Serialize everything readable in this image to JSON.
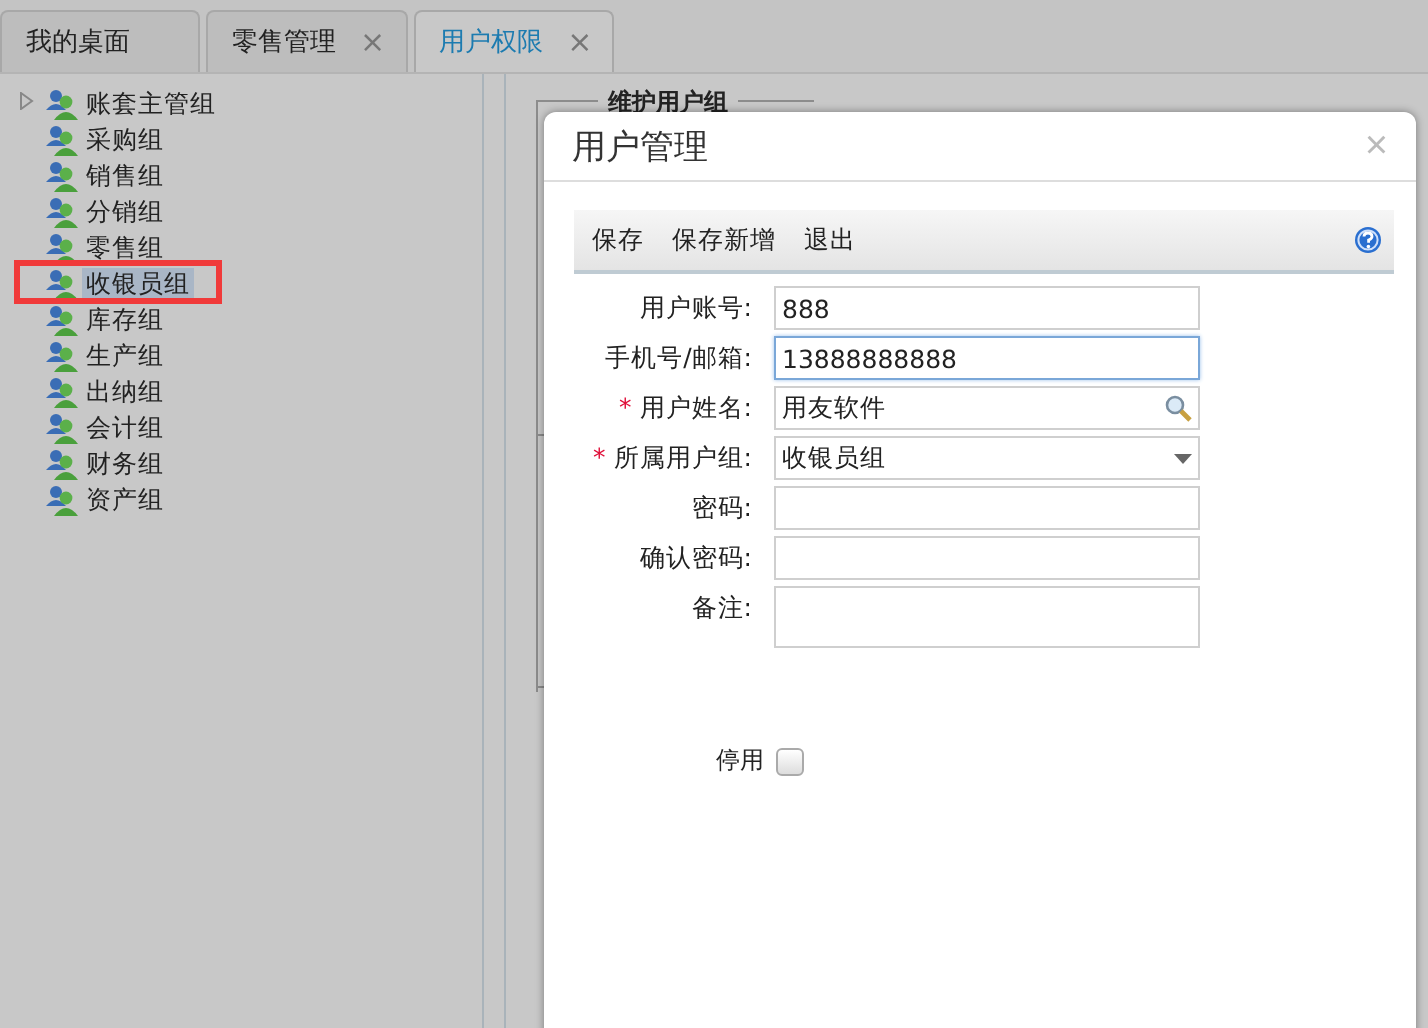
{
  "tabs": [
    {
      "label": "我的桌面",
      "selected": false
    },
    {
      "label": "零售管理",
      "close": "×",
      "selected": false
    },
    {
      "label": "用户权限",
      "close": "×",
      "selected": true
    }
  ],
  "tree": {
    "items": [
      {
        "label": "账套主管组",
        "expanded": false,
        "selected": false
      },
      {
        "label": "采购组",
        "selected": false
      },
      {
        "label": "销售组",
        "selected": false
      },
      {
        "label": "分销组",
        "selected": false
      },
      {
        "label": "零售组",
        "selected": false
      },
      {
        "label": "收银员组",
        "selected": true
      },
      {
        "label": "库存组",
        "selected": false
      },
      {
        "label": "生产组",
        "selected": false
      },
      {
        "label": "出纳组",
        "selected": false
      },
      {
        "label": "会计组",
        "selected": false
      },
      {
        "label": "财务组",
        "selected": false
      },
      {
        "label": "资产组",
        "selected": false
      }
    ]
  },
  "background_panel": {
    "legend": "维护用户组"
  },
  "dialog": {
    "title": "用户管理",
    "close": "×",
    "required_symbol": "*",
    "toolbar": [
      "保存",
      "保存新增",
      "退出"
    ],
    "fields": [
      {
        "label": "用户账号:",
        "kind": "text",
        "value": "888",
        "required": false,
        "focused": false
      },
      {
        "label": "手机号/邮箱:",
        "kind": "text",
        "value": "13888888888",
        "required": false,
        "focused": true
      },
      {
        "label": "用户姓名:",
        "kind": "lookup",
        "value": "用友软件",
        "required": true,
        "focused": false
      },
      {
        "label": "所属用户组:",
        "kind": "select",
        "value": "收银员组",
        "required": true,
        "focused": false
      },
      {
        "label": "密码:",
        "kind": "text",
        "required": false,
        "focused": false
      },
      {
        "label": "确认密码:",
        "kind": "text",
        "required": false,
        "focused": false
      },
      {
        "label": "备注:",
        "kind": "textarea",
        "required": false,
        "focused": false
      }
    ],
    "disable": {
      "label": "停用",
      "checked": false
    }
  }
}
